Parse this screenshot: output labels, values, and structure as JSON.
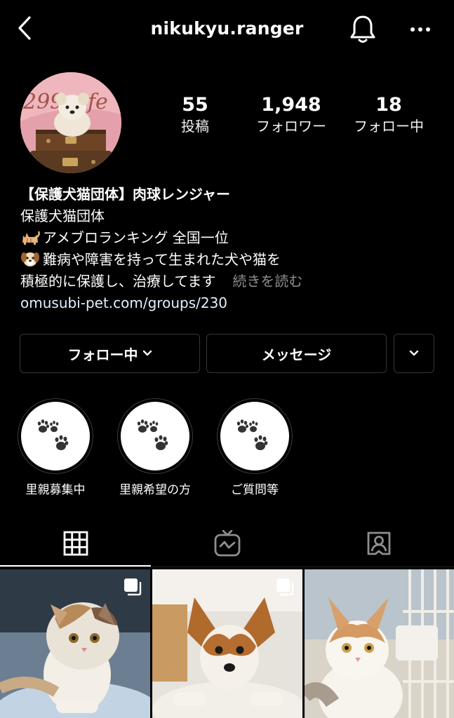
{
  "header": {
    "username": "nikukyu.ranger",
    "back_icon": "chevron-left-icon",
    "bell_icon": "bell-icon",
    "more_icon": "more-horizontal-icon"
  },
  "stats": {
    "posts_count": "55",
    "posts_label": "投稿",
    "followers_count": "1,948",
    "followers_label": "フォロワー",
    "following_count": "18",
    "following_label": "フォロー中"
  },
  "bio": {
    "name": "【保護犬猫団体】肉球レンジャー",
    "line1": "保護犬猫団体",
    "line2": "アメブロランキング 全国一位",
    "line3": "難病や障害を持って生まれた犬や猫を",
    "line4": "積極的に保護し、治療してます",
    "more": "続きを読む",
    "link": "omusubi-pet.com/groups/230",
    "emoji_line2": "cat-emoji",
    "emoji_line3": "dog-face-emoji"
  },
  "buttons": {
    "follow": "フォロー中",
    "message": "メッセージ"
  },
  "highlights": [
    {
      "title": "里親募集中",
      "icon": "paw-prints-icon"
    },
    {
      "title": "里親希望の方",
      "icon": "paw-prints-icon"
    },
    {
      "title": "ご質問等",
      "icon": "paw-prints-icon"
    }
  ],
  "tabs": [
    {
      "icon": "grid-icon",
      "active": true
    },
    {
      "icon": "igtv-icon",
      "active": false
    },
    {
      "icon": "tagged-person-icon",
      "active": false
    }
  ],
  "colors": {
    "background": "#000000",
    "text": "#ffffff",
    "muted": "#8e8e8e",
    "link": "#e0f1ff",
    "border": "#363636"
  }
}
